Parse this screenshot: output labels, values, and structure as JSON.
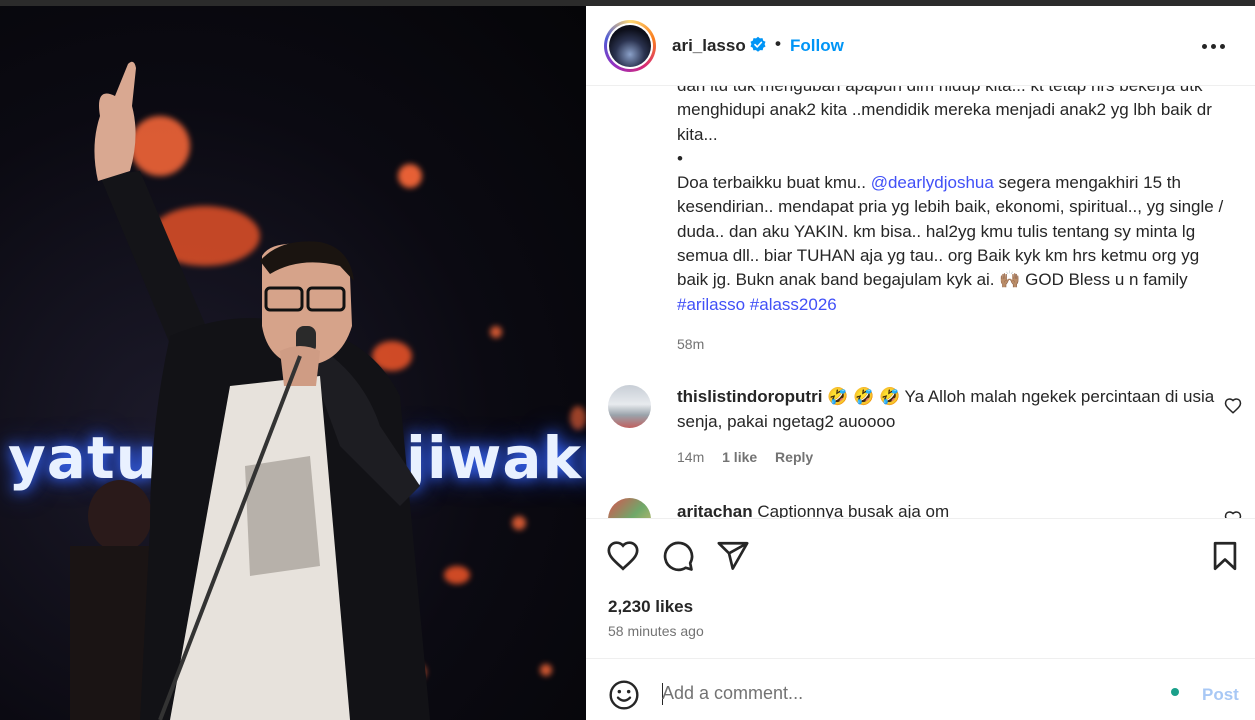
{
  "photo": {
    "screen_text_left": "yatu d",
    "screen_text_right": "jiwaku"
  },
  "post": {
    "author": "ari_lasso",
    "dot": "•",
    "follow_label": "Follow",
    "caption": {
      "line1": "dan itu tdk mengubah apapun dlm hidup kita... kt tetap hrs bekerja utk menghidupi anak2 kita ..mendidik mereka menjadi anak2 yg lbh baik dr kita...",
      "bullet": "•",
      "part_a": "Doa terbaikku buat kmu.. ",
      "mention": "@dearlydjoshua",
      "part_b": " segera mengakhiri 15 th kesendirian.. mendapat pria yg lebih baik, ekonomi, spiritual.., yg single / duda.. dan aku YAKIN. km bisa.. hal2yg kmu tulis tentang sy minta lg semua dll.. biar TUHAN aja yg tau.. org Baik kyk km hrs ketmu org yg baik jg. Bukn anak band begajulam kyk ai. 🙌🏽 GOD Bless u n family ",
      "hashtag1": "#arilasso",
      "space": " ",
      "hashtag2": "#alass2026",
      "time": "58m"
    },
    "likes": "2,230 likes",
    "posted_ago": "58 minutes ago"
  },
  "comments": [
    {
      "user": "thislistindoroputri",
      "text": " 🤣 🤣 🤣 Ya Alloh malah ngekek percintaan di usia senja, pakai ngetag2 auoooo",
      "time": "14m",
      "likes": "1 like",
      "reply": "Reply"
    },
    {
      "user": "aritachan",
      "text": " Captionnya busak aja om"
    }
  ],
  "comment_box": {
    "placeholder": "Add a comment...",
    "post_label": "Post"
  },
  "colors": {
    "link": "#4150f7",
    "follow": "#0095f6",
    "post_disabled": "#a8c8f5"
  },
  "icons": [
    "verified-badge-icon",
    "more-options-icon",
    "heart-icon",
    "comment-icon",
    "share-icon",
    "bookmark-icon",
    "emoji-icon"
  ]
}
